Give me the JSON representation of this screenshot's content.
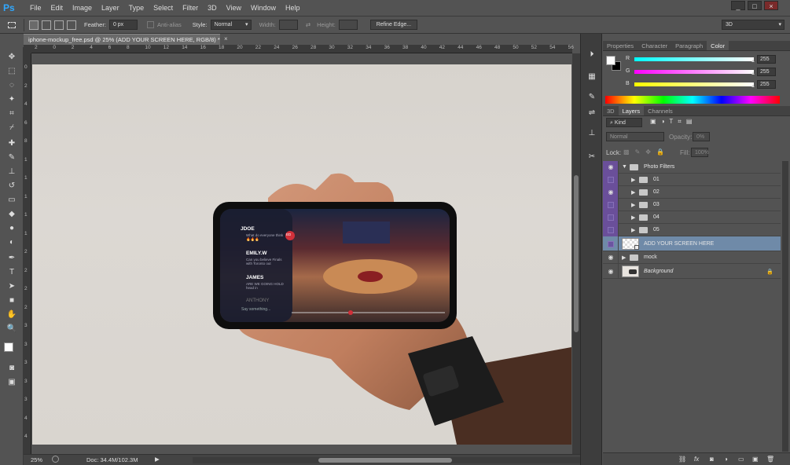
{
  "app": {
    "logo": "Ps"
  },
  "menu": [
    "File",
    "Edit",
    "Image",
    "Layer",
    "Type",
    "Select",
    "Filter",
    "3D",
    "View",
    "Window",
    "Help"
  ],
  "window_buttons": [
    "_",
    "□",
    "×"
  ],
  "options": {
    "feather_label": "Feather:",
    "feather_value": "0 px",
    "antialias_label": "Anti-alias",
    "style_label": "Style:",
    "style_value": "Normal",
    "width_label": "Width:",
    "height_label": "Height:",
    "refine_button": "Refine Edge...",
    "workspace": "3D"
  },
  "document": {
    "tab_title": "iphone-mockup_free.psd @ 25% (ADD YOUR SCREEN HERE, RGB/8) *",
    "close": "×"
  },
  "ruler": {
    "top": [
      "2",
      "0",
      "2",
      "4",
      "6",
      "8",
      "10",
      "12",
      "14",
      "16",
      "18",
      "20",
      "22",
      "24",
      "26",
      "28",
      "30",
      "32",
      "34",
      "36",
      "38",
      "40",
      "42",
      "44",
      "46",
      "48",
      "50",
      "52",
      "54",
      "56"
    ],
    "left": [
      "0",
      "2",
      "4",
      "6",
      "8",
      "1",
      "1",
      "1",
      "1",
      "1",
      "2",
      "2",
      "2",
      "2",
      "3",
      "3",
      "3",
      "3",
      "3",
      "4",
      "4"
    ]
  },
  "status": {
    "zoom": "25%",
    "doc": "Doc: 34.4M/102.3M"
  },
  "phone_screen": {
    "items": [
      {
        "name": "JDOE",
        "text": "What do everyone think 🔥🔥🔥"
      },
      {
        "name": "EMILY.W",
        "text": "Can you believe Finals with Toronto out"
      },
      {
        "name": "JAMES",
        "text": "ARE WE GOING HOLD head in"
      },
      {
        "name": "ANTHONY",
        "text": ""
      }
    ],
    "input_placeholder": "Say something...",
    "badge": "ED"
  },
  "color_panel": {
    "tabs": [
      "Properties",
      "Character",
      "Paragraph",
      "Color"
    ],
    "active_tab": "Color",
    "sliders": [
      {
        "label": "R",
        "value": "255",
        "gradient": "linear-gradient(90deg,#00ffff,#ffffff)"
      },
      {
        "label": "G",
        "value": "255",
        "gradient": "linear-gradient(90deg,#ff00ff,#ffffff)"
      },
      {
        "label": "B",
        "value": "255",
        "gradient": "linear-gradient(90deg,#ffff00,#ffffff)"
      }
    ]
  },
  "layers_panel": {
    "tabs": [
      "3D",
      "Layers",
      "Channels"
    ],
    "active_tab": "Layers",
    "filter_kind": "Kind",
    "blend_mode": "Normal",
    "opacity_label": "Opacity:",
    "opacity_value": "0%",
    "lock_label": "Lock:",
    "fill_label": "Fill:",
    "fill_value": "100%",
    "layers": [
      {
        "name": "Photo Filters",
        "type": "group",
        "indent": 0,
        "expanded": true,
        "color": "#6a4f9a",
        "visible": true
      },
      {
        "name": "01",
        "type": "group",
        "indent": 1,
        "expanded": false,
        "color": "#6a4f9a",
        "visible": false
      },
      {
        "name": "02",
        "type": "group",
        "indent": 1,
        "expanded": false,
        "color": "#6a4f9a",
        "visible": true
      },
      {
        "name": "03",
        "type": "group",
        "indent": 1,
        "expanded": false,
        "color": "#6a4f9a",
        "visible": false
      },
      {
        "name": "04",
        "type": "group",
        "indent": 1,
        "expanded": false,
        "color": "#6a4f9a",
        "visible": false
      },
      {
        "name": "05",
        "type": "group",
        "indent": 1,
        "expanded": false,
        "color": "#6a4f9a",
        "visible": false
      },
      {
        "name": "ADD YOUR SCREEN HERE",
        "type": "smart",
        "indent": 0,
        "selected": true,
        "visible": false
      },
      {
        "name": "mock",
        "type": "group",
        "indent": 0,
        "expanded": false,
        "visible": true
      },
      {
        "name": "Background",
        "type": "image",
        "indent": 0,
        "locked": true,
        "visible": true
      }
    ]
  },
  "layer_footer_icons": [
    "link-icon",
    "fx-icon",
    "mask-icon",
    "adjustment-icon",
    "group-icon",
    "new-layer-icon",
    "trash-icon"
  ]
}
